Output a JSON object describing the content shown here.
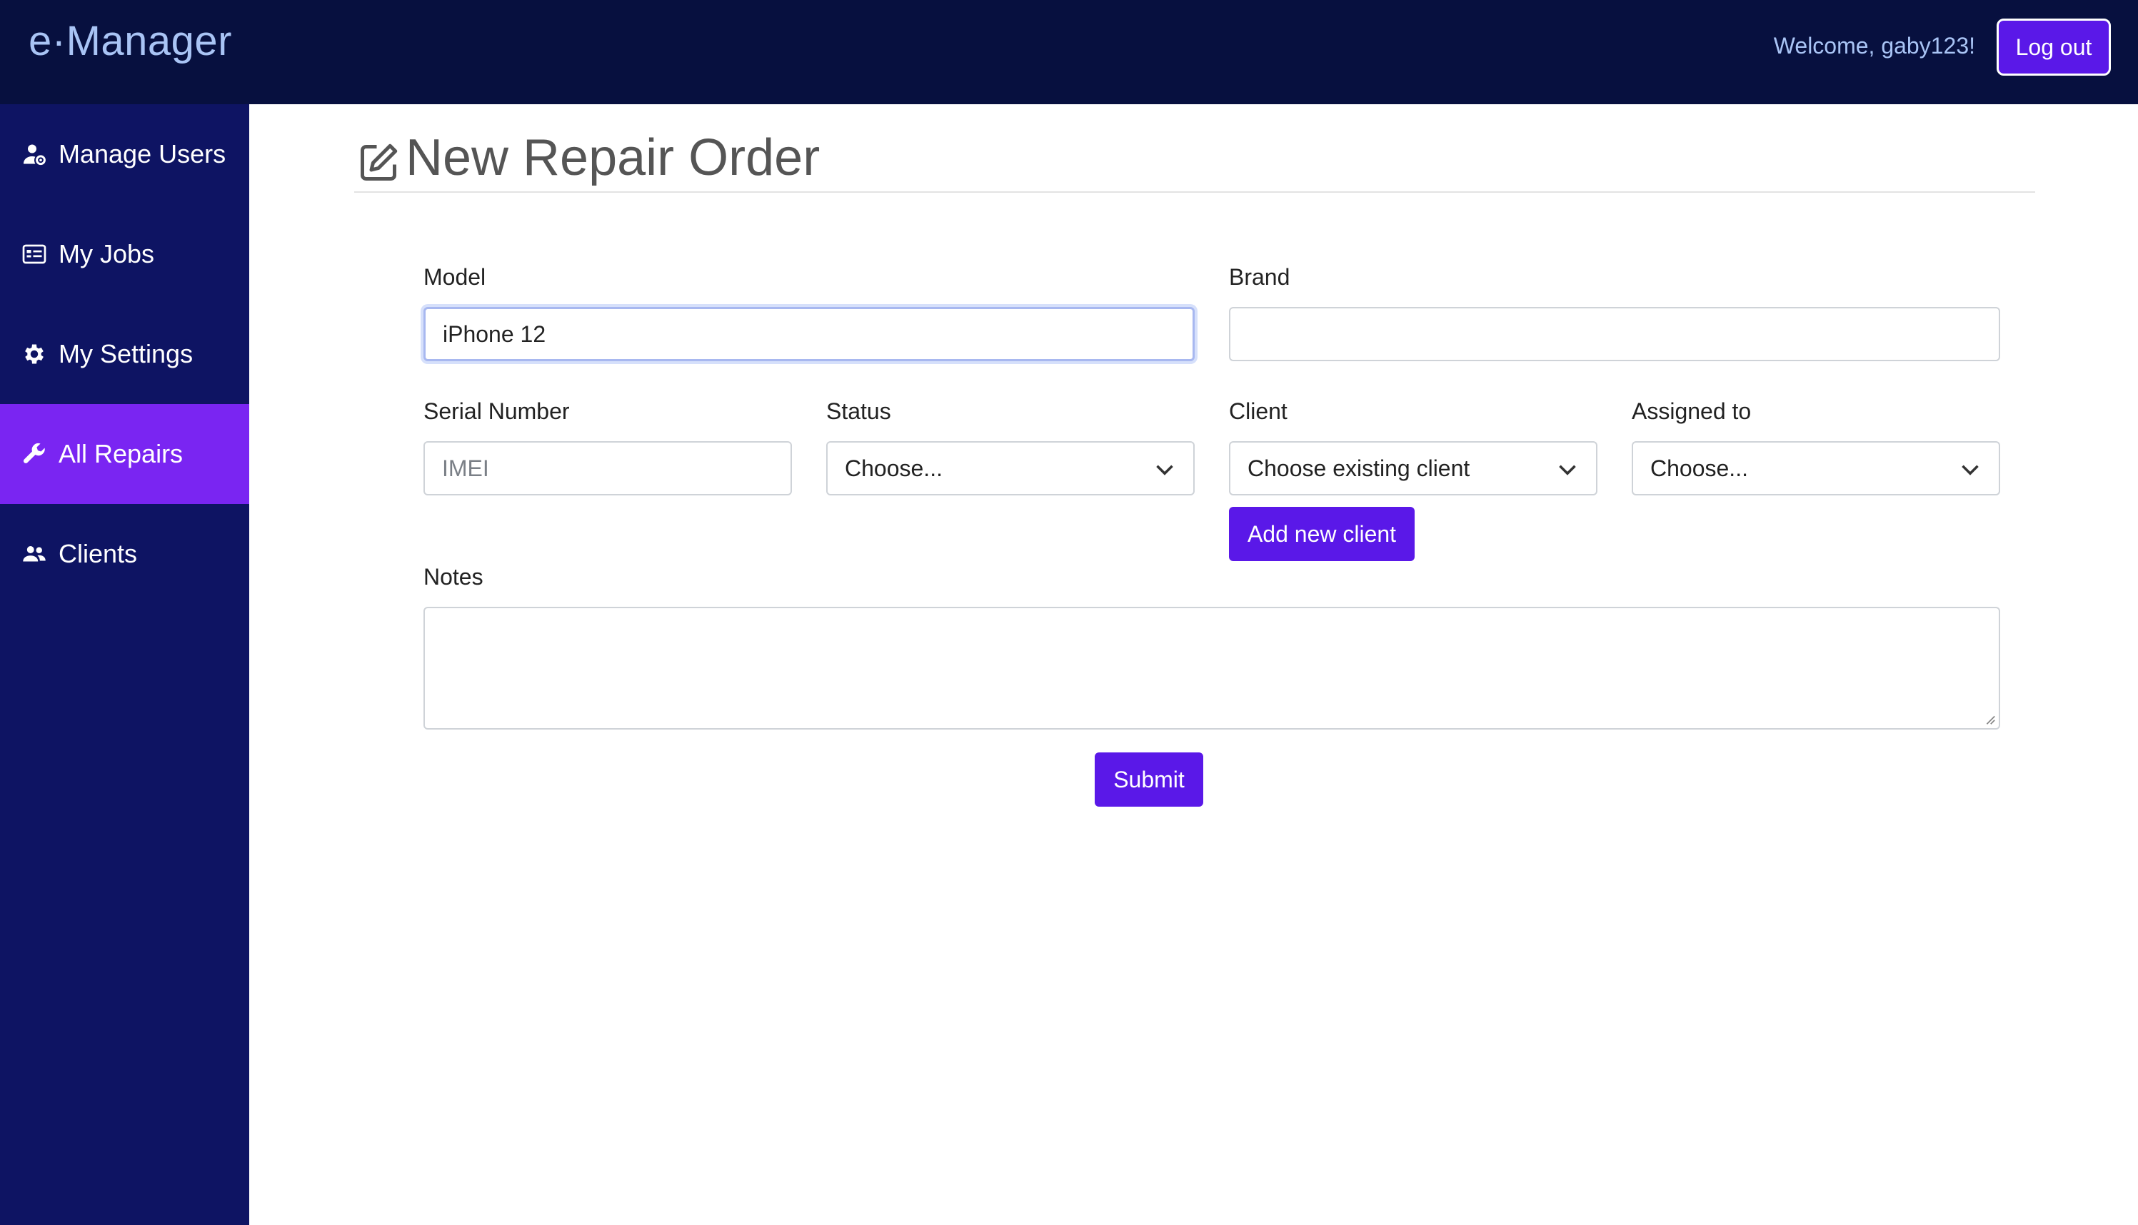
{
  "app": {
    "brand": "e·Manager",
    "welcome_text": "Welcome, gaby123!",
    "logout_label": "Log out"
  },
  "sidebar": {
    "items": [
      {
        "label": "Manage Users",
        "icon": "user-gear-icon",
        "active": false
      },
      {
        "label": "My Jobs",
        "icon": "id-card-icon",
        "active": false
      },
      {
        "label": "My Settings",
        "icon": "gear-icon",
        "active": false
      },
      {
        "label": "All Repairs",
        "icon": "wrench-icon",
        "active": true
      },
      {
        "label": "Clients",
        "icon": "people-icon",
        "active": false
      }
    ]
  },
  "page": {
    "title": "New Repair Order",
    "title_icon": "edit-icon"
  },
  "form": {
    "model": {
      "label": "Model",
      "value": "iPhone 12",
      "placeholder": ""
    },
    "brand": {
      "label": "Brand",
      "value": "",
      "placeholder": ""
    },
    "serial": {
      "label": "Serial Number",
      "value": "",
      "placeholder": "IMEI"
    },
    "status": {
      "label": "Status",
      "selected": "Choose..."
    },
    "client": {
      "label": "Client",
      "selected": "Choose existing client",
      "add_label": "Add new client"
    },
    "assigned": {
      "label": "Assigned to",
      "selected": "Choose..."
    },
    "notes": {
      "label": "Notes",
      "value": ""
    },
    "submit_label": "Submit"
  },
  "colors": {
    "topbar": "#07103f",
    "sidebar": "#0e1463",
    "active_nav": "#7a25f2",
    "primary_button": "#5a18e8",
    "brand_text": "#a9c4f5"
  }
}
